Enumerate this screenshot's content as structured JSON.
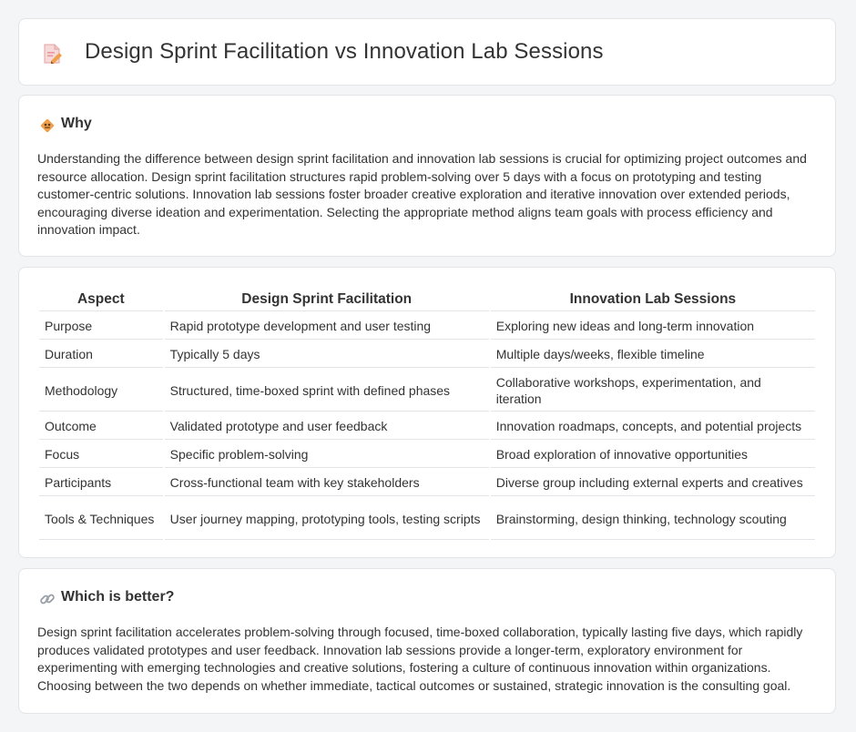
{
  "header": {
    "title": "Design Sprint Facilitation vs Innovation Lab Sessions",
    "icon": "document-pencil-icon"
  },
  "why": {
    "title": "Why",
    "icon": "warning-sign-icon",
    "text": "Understanding the difference between design sprint facilitation and innovation lab sessions is crucial for optimizing project outcomes and resource allocation. Design sprint facilitation structures rapid problem-solving over 5 days with a focus on prototyping and testing customer-centric solutions. Innovation lab sessions foster broader creative exploration and iterative innovation over extended periods, encouraging diverse ideation and experimentation. Selecting the appropriate method aligns team goals with process efficiency and innovation impact."
  },
  "table": {
    "headers": [
      "Aspect",
      "Design Sprint Facilitation",
      "Innovation Lab Sessions"
    ],
    "rows": [
      [
        "Purpose",
        "Rapid prototype development and user testing",
        "Exploring new ideas and long-term innovation"
      ],
      [
        "Duration",
        "Typically 5 days",
        "Multiple days/weeks, flexible timeline"
      ],
      [
        "Methodology",
        "Structured, time-boxed sprint with defined phases",
        "Collaborative workshops, experimentation, and iteration"
      ],
      [
        "Outcome",
        "Validated prototype and user feedback",
        "Innovation roadmaps, concepts, and potential projects"
      ],
      [
        "Focus",
        "Specific problem-solving",
        "Broad exploration of innovative opportunities"
      ],
      [
        "Participants",
        "Cross-functional team with key stakeholders",
        "Diverse group including external experts and creatives"
      ],
      [
        "Tools & Techniques",
        "User journey mapping, prototyping tools, testing scripts",
        "Brainstorming, design thinking, technology scouting"
      ]
    ]
  },
  "better": {
    "title": "Which is better?",
    "icon": "link-icon",
    "text": "Design sprint facilitation accelerates problem-solving through focused, time-boxed collaboration, typically lasting five days, which rapidly produces validated prototypes and user feedback. Innovation lab sessions provide a longer-term, exploratory environment for experimenting with emerging technologies and creative solutions, fostering a culture of continuous innovation within organizations. Choosing between the two depends on whether immediate, tactical outcomes or sustained, strategic innovation is the consulting goal."
  },
  "colors": {
    "background": "#f4f5f7",
    "card": "#ffffff",
    "border": "#e2e4e8",
    "text": "#333333",
    "icon_accent": "#f0a04b"
  }
}
